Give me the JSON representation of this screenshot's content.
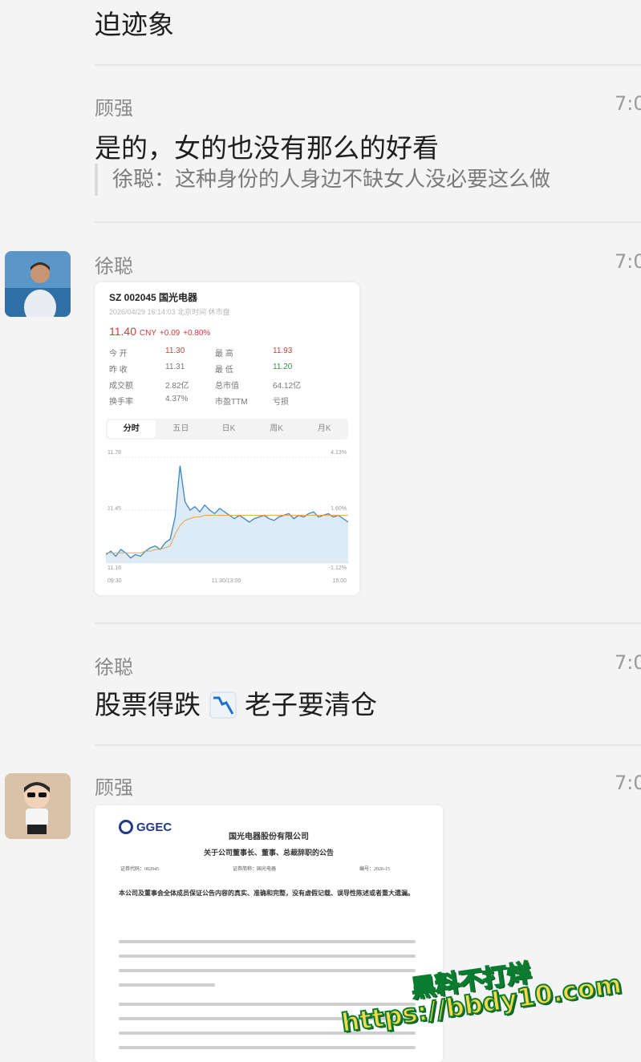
{
  "messages": [
    {
      "text": "迫迹象"
    },
    {
      "sender": "顾强",
      "time": "7:0",
      "text": "是的，女的也没有那么的好看",
      "quote": "徐聪：这种身份的人身边不缺女人没必要这么做"
    },
    {
      "sender": "徐聪",
      "time": "7:0"
    },
    {
      "sender": "徐聪",
      "time": "7:0",
      "text_before": "股票得跌",
      "emoji": "chart-decreasing",
      "text_after": "老子要清仓"
    },
    {
      "sender": "顾强",
      "time": "7:0"
    }
  ],
  "stock_card": {
    "title": "SZ 002045  国光电器",
    "date": "2026/04/29 16:14:03 北京时间 休市盘",
    "price": "11.40",
    "currency": "CNY",
    "change": "+0.09",
    "change_pct": "+0.80%",
    "stats": [
      [
        "今  开",
        "11.30",
        "最  高",
        "11.93"
      ],
      [
        "昨  收",
        "11.31",
        "最  低",
        "11.20"
      ],
      [
        "成交额",
        "2.82亿",
        "总市值",
        "64.12亿"
      ],
      [
        "换手率",
        "4.37%",
        "市盈TTM",
        "亏损"
      ]
    ],
    "tabs": [
      "分时",
      "五日",
      "日K",
      "周K",
      "月K"
    ],
    "active_tab": "分时",
    "axis": {
      "y_top": "11.78",
      "y_mid": "11.45",
      "y_bottom": "11.16",
      "pct_top": "4.13%",
      "pct_mid": "1.60%",
      "pct_bottom": "-1.12%",
      "x_start": "09:30",
      "x_mid": "11:30/13:00",
      "x_end": "15:00"
    },
    "colors": {
      "up": "#d23b3b",
      "down": "#2e9a49",
      "line": "#3c86c6",
      "avg": "#e0a84a"
    }
  },
  "chart_data": {
    "type": "area",
    "x_range": [
      "09:30",
      "15:00"
    ],
    "ylim": [
      11.16,
      11.78
    ],
    "series": [
      {
        "values": [
          11.21,
          11.23,
          11.2,
          11.24,
          11.22,
          11.19,
          11.21,
          11.2,
          11.23,
          11.25,
          11.26,
          11.24,
          11.28,
          11.3,
          11.43,
          11.73,
          11.52,
          11.47,
          11.49,
          11.46,
          11.5,
          11.47,
          11.45,
          11.48,
          11.46,
          11.44,
          11.42,
          11.44,
          11.42,
          11.4,
          11.42,
          11.43,
          11.44,
          11.42,
          11.41,
          11.43,
          11.44,
          11.45,
          11.42,
          11.44,
          11.43,
          11.45,
          11.46,
          11.43,
          11.44,
          11.45,
          11.43,
          11.44,
          11.42,
          11.4
        ]
      },
      {
        "values": [
          11.22,
          11.22,
          11.22,
          11.22,
          11.22,
          11.22,
          11.22,
          11.22,
          11.23,
          11.23,
          11.24,
          11.24,
          11.25,
          11.26,
          11.33,
          11.38,
          11.41,
          11.42,
          11.43,
          11.43,
          11.44,
          11.44,
          11.44,
          11.44,
          11.44,
          11.44,
          11.44,
          11.44,
          11.44,
          11.44,
          11.44,
          11.44,
          11.44,
          11.44,
          11.44,
          11.44,
          11.44,
          11.44,
          11.44,
          11.44,
          11.44,
          11.44,
          11.44,
          11.44,
          11.44,
          11.44,
          11.44,
          11.44,
          11.44,
          11.44
        ]
      }
    ]
  },
  "doc_card": {
    "logo": "GGEC",
    "company": "国光电器股份有限公司",
    "heading": "关于公司董事长、董事、总裁辞职的公告",
    "stock_code": "证券代码：002045",
    "stock_name": "证券简称：国光电器",
    "notice_no": "编号：2026-15",
    "statement": "本公司及董事会全体成员保证公告内容的真实、准确和完整，没有虚假记载、误导性陈述或者重大遗漏。"
  },
  "watermark": {
    "line1": "黑料不打烊",
    "line2": "https://bbdy10.com"
  }
}
